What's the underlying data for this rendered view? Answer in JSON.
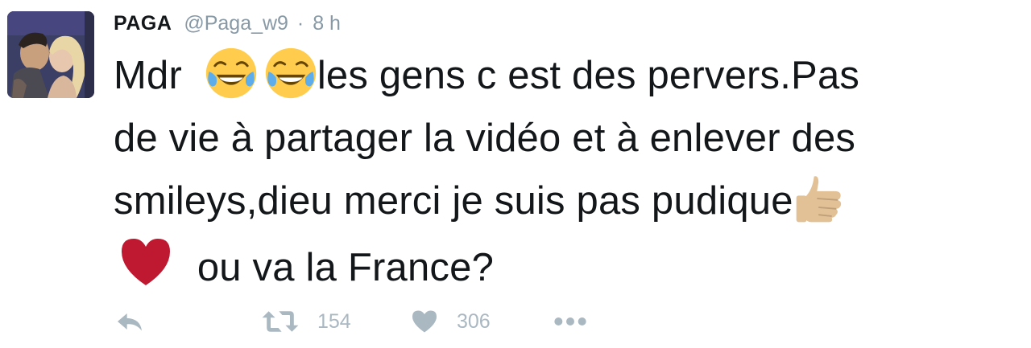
{
  "tweet": {
    "display_name": "PAGA",
    "handle": "@Paga_w9",
    "separator": "·",
    "time": "8 h",
    "text": {
      "line1_a": "Mdr",
      "line1_b": "les gens c est des pervers.Pas",
      "line2": "de vie à partager la vidéo et à enlever des",
      "line3": "smileys,dieu merci je suis pas pudique",
      "line4": "ou va la France?"
    },
    "emojis": [
      "face-with-tears-of-joy-icon",
      "face-with-tears-of-joy-icon",
      "thumbs-up-icon",
      "red-heart-icon"
    ]
  },
  "actions": {
    "retweet_count": "154",
    "like_count": "306"
  },
  "colors": {
    "text": "#14171a",
    "muted": "#8899a6",
    "action_icon": "#aab8c2",
    "heart": "#be1931",
    "emoji_face": "#ffcc4d",
    "emoji_tears": "#5dadec",
    "thumb_skin": "#e2c196"
  }
}
